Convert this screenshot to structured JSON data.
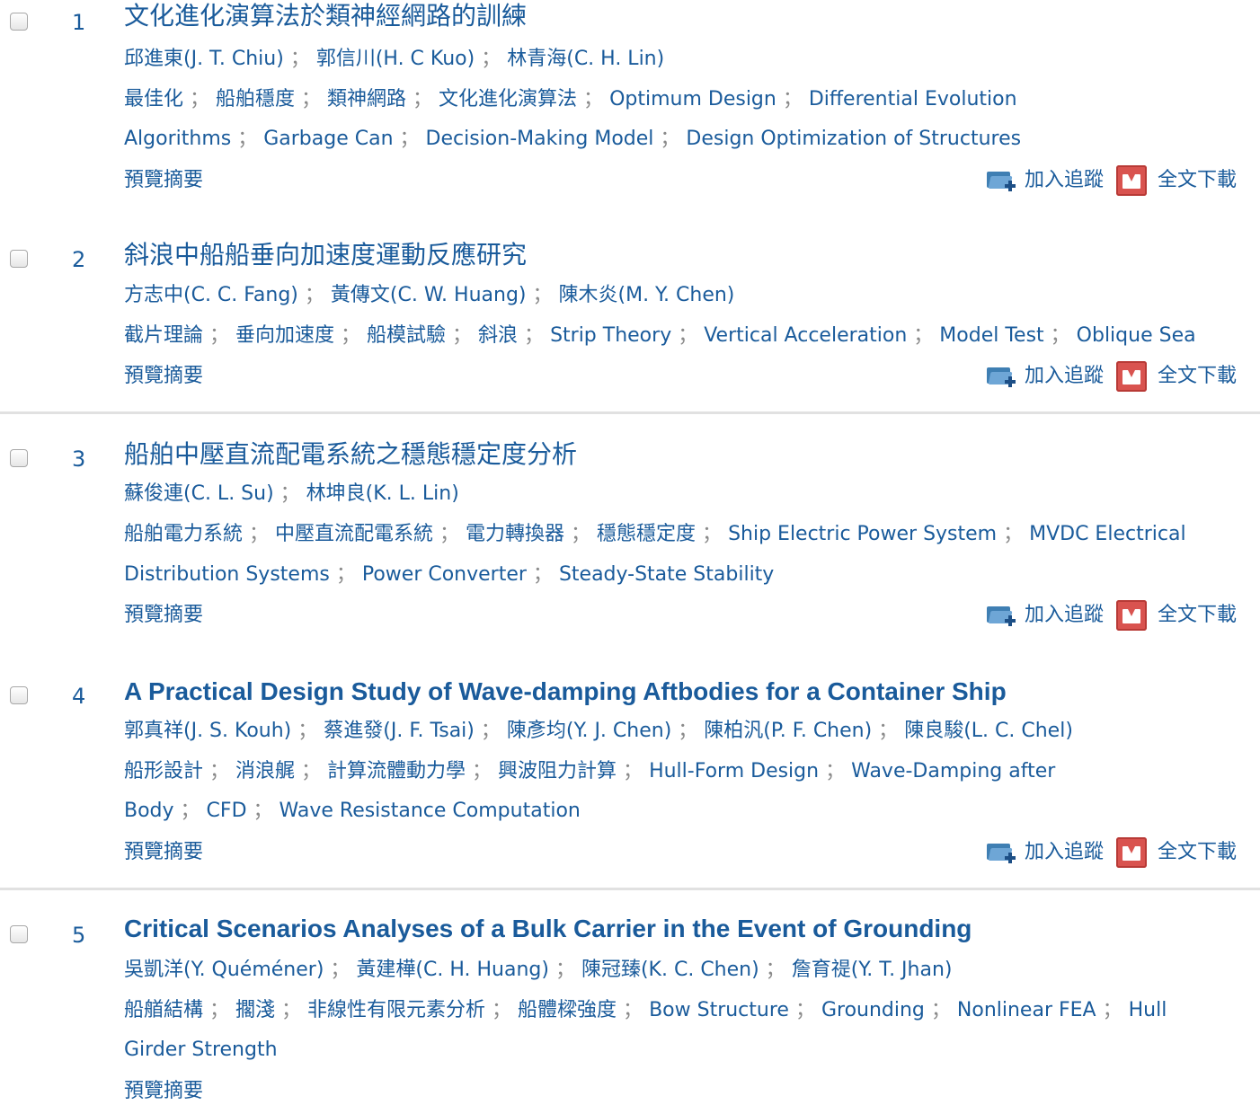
{
  "labels": {
    "preview": "預覽摘要",
    "track": "加入追蹤",
    "download": "全文下載",
    "sep": "；"
  },
  "results": [
    {
      "num": "1",
      "title": "文化進化演算法於類神經網路的訓練",
      "authors": [
        "邱進東(J. T. Chiu)",
        "郭信川(H. C Kuo)",
        "林青海(C. H. Lin)"
      ],
      "keywords_line1": [
        "最佳化",
        "船舶穩度",
        "類神網路",
        "文化進化演算法",
        "Optimum Design",
        "Differential Evolution"
      ],
      "keywords_line2": [
        "Algorithms",
        "Garbage Can",
        "Decision-Making Model",
        "Design Optimization of Structures"
      ]
    },
    {
      "num": "2",
      "title": "斜浪中船船垂向加速度運動反應研究",
      "authors": [
        "方志中(C. C. Fang)",
        "黃傳文(C. W. Huang)",
        "陳木炎(M. Y. Chen)"
      ],
      "keywords_line1": [
        "截片理論",
        "垂向加速度",
        "船模試驗",
        "斜浪",
        "Strip Theory",
        "Vertical Acceleration",
        "Model Test",
        "Oblique Sea"
      ]
    },
    {
      "num": "3",
      "title": "船舶中壓直流配電系統之穩態穩定度分析",
      "authors": [
        "蘇俊連(C. L. Su)",
        "林坤良(K. L. Lin)"
      ],
      "keywords_line1": [
        "船舶電力系統",
        "中壓直流配電系統",
        "電力轉換器",
        "穩態穩定度",
        "Ship Electric Power System",
        "MVDC Electrical"
      ],
      "keywords_line2": [
        "Distribution Systems",
        "Power Converter",
        "Steady-State Stability"
      ]
    },
    {
      "num": "4",
      "title": "A Practical Design Study of Wave-damping Aftbodies for a Container Ship",
      "authors": [
        "郭真祥(J. S. Kouh)",
        "蔡進發(J. F. Tsai)",
        "陳彥均(Y. J. Chen)",
        "陳柏汎(P. F. Chen)",
        "陳良駿(L. C. Chel)"
      ],
      "keywords_line1": [
        "船形設計",
        "消浪艉",
        "計算流體動力學",
        "興波阻力計算",
        "Hull-Form Design",
        "Wave-Damping after"
      ],
      "keywords_line2": [
        "Body",
        "CFD",
        "Wave Resistance Computation"
      ]
    },
    {
      "num": "5",
      "title": "Critical Scenarios Analyses of a Bulk Carrier in the Event of Grounding",
      "authors": [
        "吳凱洋(Y. Quéméner)",
        "黃建樺(C. H. Huang)",
        "陳冠臻(K. C. Chen)",
        "詹育禔(Y. T. Jhan)"
      ],
      "keywords_line1": [
        "船艏結構",
        "擱淺",
        "非線性有限元素分析",
        "船體樑強度",
        "Bow Structure",
        "Grounding",
        "Nonlinear FEA",
        "Hull"
      ],
      "keywords_line2": [
        "Girder Strength"
      ]
    }
  ]
}
